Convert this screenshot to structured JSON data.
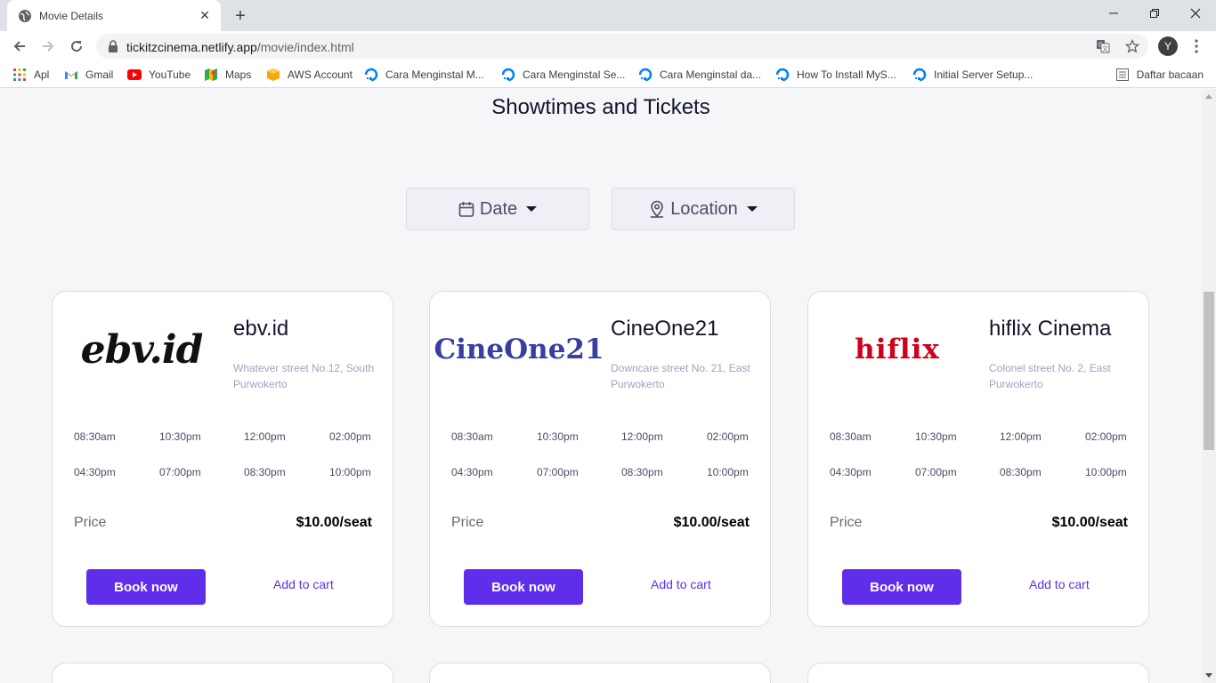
{
  "browser": {
    "tab_title": "Movie Details",
    "url_host": "tickitzcinema.netlify.app",
    "url_path": "/movie/index.html",
    "profile_initial": "Y",
    "bookmarks": [
      {
        "label": "Apl",
        "icon": "apps-grid-icon"
      },
      {
        "label": "Gmail",
        "icon": "gmail-icon"
      },
      {
        "label": "YouTube",
        "icon": "youtube-icon"
      },
      {
        "label": "Maps",
        "icon": "maps-icon"
      },
      {
        "label": "AWS Account",
        "icon": "aws-icon"
      },
      {
        "label": "Cara Menginstal M...",
        "icon": "digitalocean-icon"
      },
      {
        "label": "Cara Menginstal Se...",
        "icon": "digitalocean-icon"
      },
      {
        "label": "Cara Menginstal da...",
        "icon": "digitalocean-icon"
      },
      {
        "label": "How To Install MyS...",
        "icon": "digitalocean-icon"
      },
      {
        "label": "Initial Server Setup...",
        "icon": "digitalocean-icon"
      }
    ],
    "reading_list": "Daftar bacaan"
  },
  "page": {
    "title": "Showtimes and Tickets",
    "filters": {
      "date_label": "Date",
      "location_label": "Location"
    },
    "colors": {
      "primary": "#5f2eea",
      "text_dark": "#14142b",
      "muted": "#a0a3bd"
    },
    "cinemas": [
      {
        "logo_text": "ebv.id",
        "name": "ebv.id",
        "address": "Whatever street No.12, South Purwokerto",
        "times": [
          "08:30am",
          "10:30pm",
          "12:00pm",
          "02:00pm",
          "04:30pm",
          "07:00pm",
          "08:30pm",
          "10:00pm"
        ],
        "price_label": "Price",
        "price": "$10.00/seat",
        "book_label": "Book now",
        "cart_label": "Add to cart"
      },
      {
        "logo_text": "CineOne21",
        "name": "CineOne21",
        "address": "Downcare street No. 21, East Purwokerto",
        "times": [
          "08:30am",
          "10:30pm",
          "12:00pm",
          "02:00pm",
          "04:30pm",
          "07:00pm",
          "08:30pm",
          "10:00pm"
        ],
        "price_label": "Price",
        "price": "$10.00/seat",
        "book_label": "Book now",
        "cart_label": "Add to cart"
      },
      {
        "logo_text": "hiflix",
        "name": "hiflix Cinema",
        "address": "Colonel street No. 2, East Purwokerto",
        "times": [
          "08:30am",
          "10:30pm",
          "12:00pm",
          "02:00pm",
          "04:30pm",
          "07:00pm",
          "08:30pm",
          "10:00pm"
        ],
        "price_label": "Price",
        "price": "$10.00/seat",
        "book_label": "Book now",
        "cart_label": "Add to cart"
      }
    ]
  }
}
